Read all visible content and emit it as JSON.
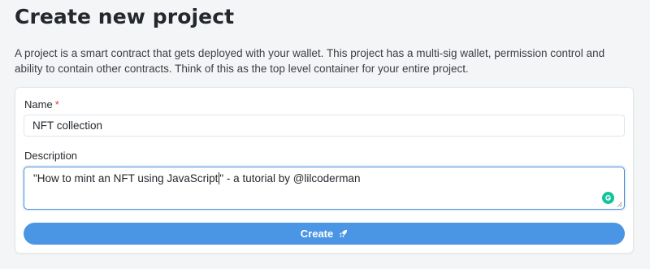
{
  "page": {
    "title": "Create new project",
    "description": "A project is a smart contract that gets deployed with your wallet. This project has a multi-sig wallet, permission control and ability to contain other contracts. Think of this as the top level container for your entire project."
  },
  "form": {
    "name": {
      "label": "Name",
      "required_marker": "*",
      "value": "NFT collection"
    },
    "description": {
      "label": "Description",
      "value_before_caret": "\"How to mint an NFT using JavaScript",
      "value_after_caret": "\" - a tutorial by @lilcoderman"
    },
    "create_button": {
      "label": "Create",
      "icon": "rocket-icon"
    }
  },
  "icons": {
    "grammarly": "grammarly-icon",
    "resize": "resize-handle-icon"
  },
  "colors": {
    "accent": "#4a96e4",
    "focus_border": "#4d8fd6",
    "required": "#e03b3b",
    "grammarly": "#15c39a"
  }
}
